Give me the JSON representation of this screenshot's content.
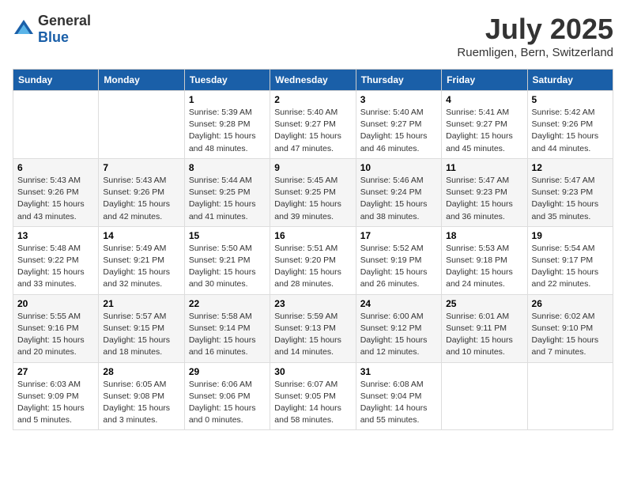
{
  "header": {
    "logo_general": "General",
    "logo_blue": "Blue",
    "month": "July 2025",
    "location": "Ruemligen, Bern, Switzerland"
  },
  "days_of_week": [
    "Sunday",
    "Monday",
    "Tuesday",
    "Wednesday",
    "Thursday",
    "Friday",
    "Saturday"
  ],
  "weeks": [
    [
      {
        "day": "",
        "info": ""
      },
      {
        "day": "",
        "info": ""
      },
      {
        "day": "1",
        "info": "Sunrise: 5:39 AM\nSunset: 9:28 PM\nDaylight: 15 hours\nand 48 minutes."
      },
      {
        "day": "2",
        "info": "Sunrise: 5:40 AM\nSunset: 9:27 PM\nDaylight: 15 hours\nand 47 minutes."
      },
      {
        "day": "3",
        "info": "Sunrise: 5:40 AM\nSunset: 9:27 PM\nDaylight: 15 hours\nand 46 minutes."
      },
      {
        "day": "4",
        "info": "Sunrise: 5:41 AM\nSunset: 9:27 PM\nDaylight: 15 hours\nand 45 minutes."
      },
      {
        "day": "5",
        "info": "Sunrise: 5:42 AM\nSunset: 9:26 PM\nDaylight: 15 hours\nand 44 minutes."
      }
    ],
    [
      {
        "day": "6",
        "info": "Sunrise: 5:43 AM\nSunset: 9:26 PM\nDaylight: 15 hours\nand 43 minutes."
      },
      {
        "day": "7",
        "info": "Sunrise: 5:43 AM\nSunset: 9:26 PM\nDaylight: 15 hours\nand 42 minutes."
      },
      {
        "day": "8",
        "info": "Sunrise: 5:44 AM\nSunset: 9:25 PM\nDaylight: 15 hours\nand 41 minutes."
      },
      {
        "day": "9",
        "info": "Sunrise: 5:45 AM\nSunset: 9:25 PM\nDaylight: 15 hours\nand 39 minutes."
      },
      {
        "day": "10",
        "info": "Sunrise: 5:46 AM\nSunset: 9:24 PM\nDaylight: 15 hours\nand 38 minutes."
      },
      {
        "day": "11",
        "info": "Sunrise: 5:47 AM\nSunset: 9:23 PM\nDaylight: 15 hours\nand 36 minutes."
      },
      {
        "day": "12",
        "info": "Sunrise: 5:47 AM\nSunset: 9:23 PM\nDaylight: 15 hours\nand 35 minutes."
      }
    ],
    [
      {
        "day": "13",
        "info": "Sunrise: 5:48 AM\nSunset: 9:22 PM\nDaylight: 15 hours\nand 33 minutes."
      },
      {
        "day": "14",
        "info": "Sunrise: 5:49 AM\nSunset: 9:21 PM\nDaylight: 15 hours\nand 32 minutes."
      },
      {
        "day": "15",
        "info": "Sunrise: 5:50 AM\nSunset: 9:21 PM\nDaylight: 15 hours\nand 30 minutes."
      },
      {
        "day": "16",
        "info": "Sunrise: 5:51 AM\nSunset: 9:20 PM\nDaylight: 15 hours\nand 28 minutes."
      },
      {
        "day": "17",
        "info": "Sunrise: 5:52 AM\nSunset: 9:19 PM\nDaylight: 15 hours\nand 26 minutes."
      },
      {
        "day": "18",
        "info": "Sunrise: 5:53 AM\nSunset: 9:18 PM\nDaylight: 15 hours\nand 24 minutes."
      },
      {
        "day": "19",
        "info": "Sunrise: 5:54 AM\nSunset: 9:17 PM\nDaylight: 15 hours\nand 22 minutes."
      }
    ],
    [
      {
        "day": "20",
        "info": "Sunrise: 5:55 AM\nSunset: 9:16 PM\nDaylight: 15 hours\nand 20 minutes."
      },
      {
        "day": "21",
        "info": "Sunrise: 5:57 AM\nSunset: 9:15 PM\nDaylight: 15 hours\nand 18 minutes."
      },
      {
        "day": "22",
        "info": "Sunrise: 5:58 AM\nSunset: 9:14 PM\nDaylight: 15 hours\nand 16 minutes."
      },
      {
        "day": "23",
        "info": "Sunrise: 5:59 AM\nSunset: 9:13 PM\nDaylight: 15 hours\nand 14 minutes."
      },
      {
        "day": "24",
        "info": "Sunrise: 6:00 AM\nSunset: 9:12 PM\nDaylight: 15 hours\nand 12 minutes."
      },
      {
        "day": "25",
        "info": "Sunrise: 6:01 AM\nSunset: 9:11 PM\nDaylight: 15 hours\nand 10 minutes."
      },
      {
        "day": "26",
        "info": "Sunrise: 6:02 AM\nSunset: 9:10 PM\nDaylight: 15 hours\nand 7 minutes."
      }
    ],
    [
      {
        "day": "27",
        "info": "Sunrise: 6:03 AM\nSunset: 9:09 PM\nDaylight: 15 hours\nand 5 minutes."
      },
      {
        "day": "28",
        "info": "Sunrise: 6:05 AM\nSunset: 9:08 PM\nDaylight: 15 hours\nand 3 minutes."
      },
      {
        "day": "29",
        "info": "Sunrise: 6:06 AM\nSunset: 9:06 PM\nDaylight: 15 hours\nand 0 minutes."
      },
      {
        "day": "30",
        "info": "Sunrise: 6:07 AM\nSunset: 9:05 PM\nDaylight: 14 hours\nand 58 minutes."
      },
      {
        "day": "31",
        "info": "Sunrise: 6:08 AM\nSunset: 9:04 PM\nDaylight: 14 hours\nand 55 minutes."
      },
      {
        "day": "",
        "info": ""
      },
      {
        "day": "",
        "info": ""
      }
    ]
  ]
}
